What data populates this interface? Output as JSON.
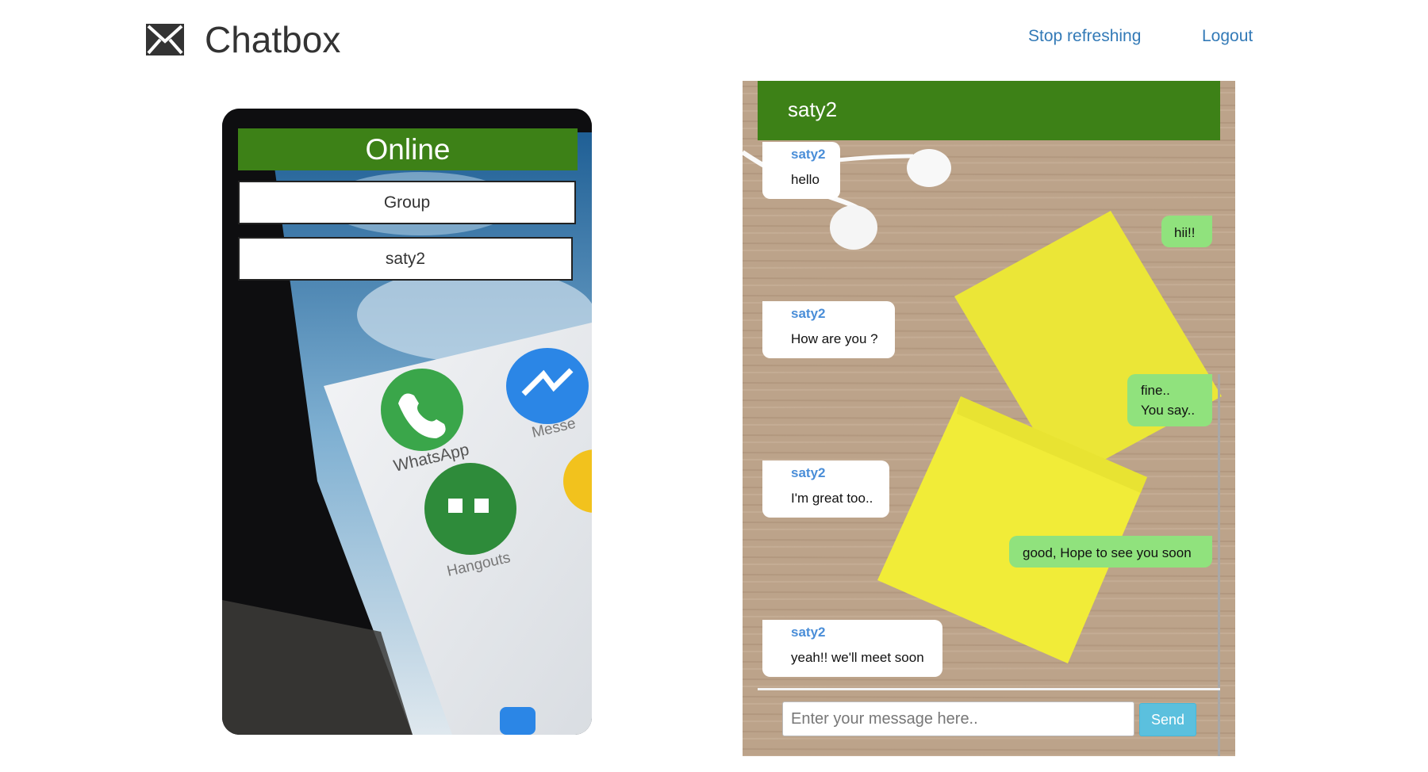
{
  "navbar": {
    "brand_icon": "envelope-icon",
    "brand_title": "Chatbox",
    "stop_refreshing_label": "Stop refreshing",
    "logout_label": "Logout"
  },
  "online_panel": {
    "title": "Online",
    "users": [
      {
        "label": "Group"
      },
      {
        "label": "saty2"
      }
    ],
    "background_app_labels": [
      "WhatsApp",
      "Hangouts",
      "Messe"
    ]
  },
  "chat": {
    "contact_name": "saty2",
    "messages": [
      {
        "direction": "incoming",
        "sender": "saty2",
        "text": "hello"
      },
      {
        "direction": "outgoing",
        "lines": [
          "hii!!"
        ]
      },
      {
        "direction": "incoming",
        "sender": "saty2",
        "text": "How are you ?"
      },
      {
        "direction": "outgoing",
        "lines": [
          "fine..",
          "You say.."
        ]
      },
      {
        "direction": "incoming",
        "sender": "saty2",
        "text": "I'm great too.."
      },
      {
        "direction": "outgoing",
        "lines": [
          "good, Hope to see you soon"
        ]
      },
      {
        "direction": "incoming",
        "sender": "saty2",
        "text": "yeah!! we'll meet soon"
      }
    ],
    "input_placeholder": "Enter your message here..",
    "input_value": "",
    "send_label": "Send"
  },
  "colors": {
    "header_green": "#3d8117",
    "outgoing_bubble": "#90e27d",
    "sender_blue": "#4a8ed8",
    "link_blue": "#337ab7",
    "send_button": "#5bc0de"
  }
}
